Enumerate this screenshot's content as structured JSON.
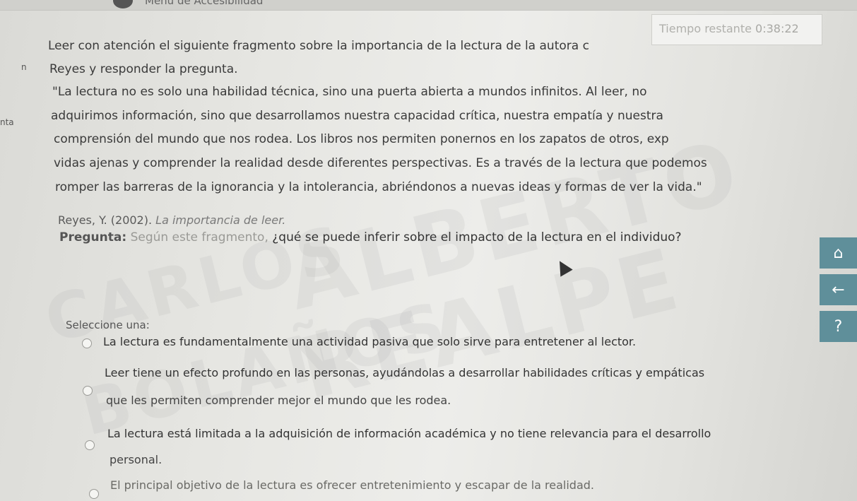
{
  "header": {
    "accessibility_menu": "Menú de Accesibilidad"
  },
  "timer": {
    "label": "Tiempo restante",
    "value": "0:38:22"
  },
  "left_fragments": [
    "n",
    "nta"
  ],
  "intro": {
    "line1": "Leer con atención el siguiente fragmento sobre la importancia de la lectura de la autora c",
    "line2": "Reyes y responder la pregunta."
  },
  "quote": [
    "\"La lectura no es solo una habilidad técnica, sino una puerta abierta a mundos infinitos. Al leer, no",
    "adquirimos información, sino que desarrollamos nuestra capacidad crítica, nuestra empatía y nuestra",
    "comprensión del mundo que nos rodea. Los libros nos permiten ponernos en los zapatos de otros, exp",
    "vidas ajenas y comprender la realidad desde diferentes perspectivas. Es a través de la lectura que podemos",
    "romper las barreras de la ignorancia y la intolerancia, abriéndonos a nuevas ideas y formas de ver la vida.\""
  ],
  "reference": {
    "author": "Reyes, Y. (2002).",
    "title": "La importancia de leer."
  },
  "question": {
    "label": "Pregunta:",
    "lead": "Según este fragmento,",
    "text": "¿qué se puede inferir sobre el impacto de la lectura en el individuo?"
  },
  "select_label": "Seleccione una:",
  "options": [
    {
      "line1": "La lectura es fundamentalmente una actividad pasiva que solo sirve para entretener al lector.",
      "line2": ""
    },
    {
      "line1": "Leer tiene un efecto profundo en las personas, ayudándolas a desarrollar habilidades críticas y empáticas",
      "line2": "que les permiten comprender mejor el mundo que les rodea."
    },
    {
      "line1": "La lectura está limitada a la adquisición de información académica y no tiene relevancia para el desarrollo",
      "line2": "personal."
    },
    {
      "line1": "El principal objetivo de la lectura es ofrecer entretenimiento y escapar de la realidad.",
      "line2": ""
    }
  ],
  "watermark": {
    "line1": "ALBERTO",
    "line2": "CARLOS",
    "line3": "REALPE",
    "line4": "BOLAÑOS"
  },
  "side_buttons": {
    "home": "⌂",
    "back": "←",
    "help": "?"
  }
}
